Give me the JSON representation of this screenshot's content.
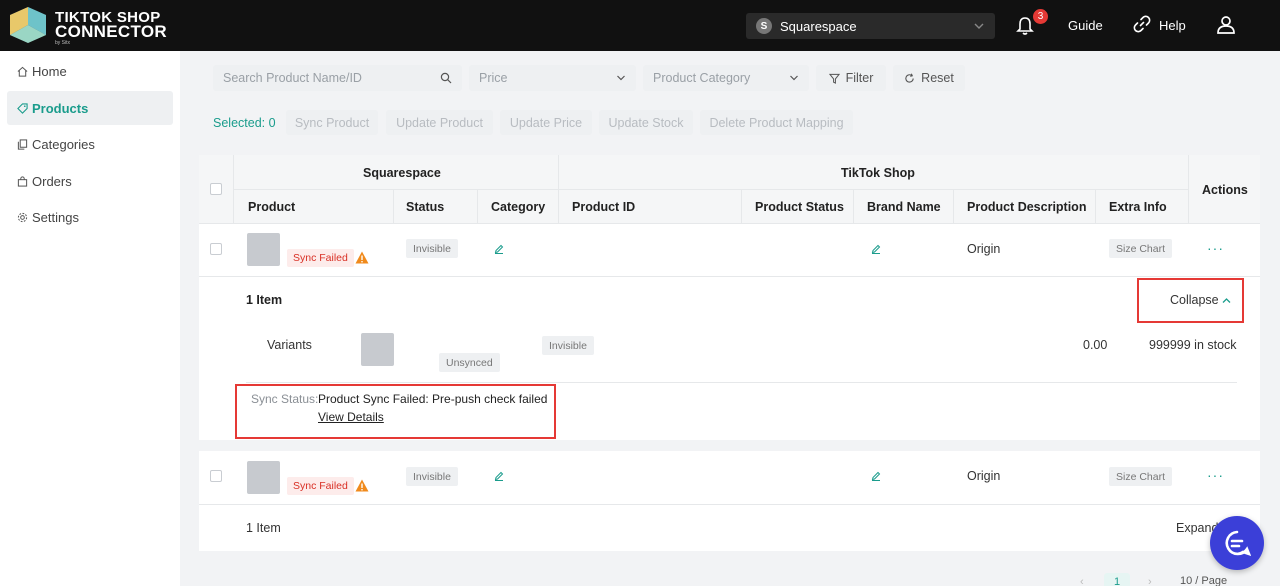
{
  "header": {
    "brand_line1": "TIKTOK SHOP",
    "brand_line2": "CONNECTOR",
    "brand_by": "by Sitx",
    "store_initial": "S",
    "store_name": "Squarespace",
    "notification_count": "3",
    "guide_label": "Guide",
    "help_label": "Help"
  },
  "sidebar": {
    "items": [
      {
        "label": "Home",
        "icon": "home-icon"
      },
      {
        "label": "Products",
        "icon": "tag-icon",
        "active": true
      },
      {
        "label": "Categories",
        "icon": "copy-icon"
      },
      {
        "label": "Orders",
        "icon": "bag-icon"
      },
      {
        "label": "Settings",
        "icon": "gear-icon"
      }
    ]
  },
  "filters": {
    "search_placeholder": "Search Product Name/ID",
    "price_placeholder": "Price",
    "category_placeholder": "Product Category",
    "filter_label": "Filter",
    "reset_label": "Reset"
  },
  "bulk": {
    "selected_label": "Selected: 0",
    "sync_product": "Sync Product",
    "update_product": "Update Product",
    "update_price": "Update Price",
    "update_stock": "Update Stock",
    "delete_mapping": "Delete Product Mapping"
  },
  "table": {
    "group_left": "Squarespace",
    "group_right": "TikTok Shop",
    "columns": {
      "product": "Product",
      "status": "Status",
      "category": "Category",
      "product_id": "Product ID",
      "product_status": "Product Status",
      "brand_name": "Brand Name",
      "product_description": "Product Description",
      "extra_info": "Extra Info",
      "actions": "Actions"
    },
    "rows": [
      {
        "sync_tag": "Sync Failed",
        "status": "Invisible",
        "product_description": "Origin",
        "extra_info": "Size Chart",
        "more": "···",
        "item_count": "1 Item",
        "toggle": "Collapse",
        "variant_label": "Variants",
        "variant_sync": "Unsynced",
        "variant_status": "Invisible",
        "variant_price": "0.00",
        "variant_stock": "999999 in stock",
        "sync_status_label": "Sync Status:",
        "sync_status_text": "Product Sync Failed: Pre-push check failed",
        "view_details": "View Details"
      },
      {
        "sync_tag": "Sync Failed",
        "status": "Invisible",
        "product_description": "Origin",
        "extra_info": "Size Chart",
        "more": "···",
        "item_count": "1 Item",
        "toggle": "Expand"
      }
    ]
  },
  "pagination": {
    "current_page": "1",
    "page_size": "10 / Page"
  },
  "colors": {
    "accent": "#1a9c8c",
    "danger": "#e53935",
    "topbar": "#111111",
    "chat": "#3b3fd8"
  }
}
